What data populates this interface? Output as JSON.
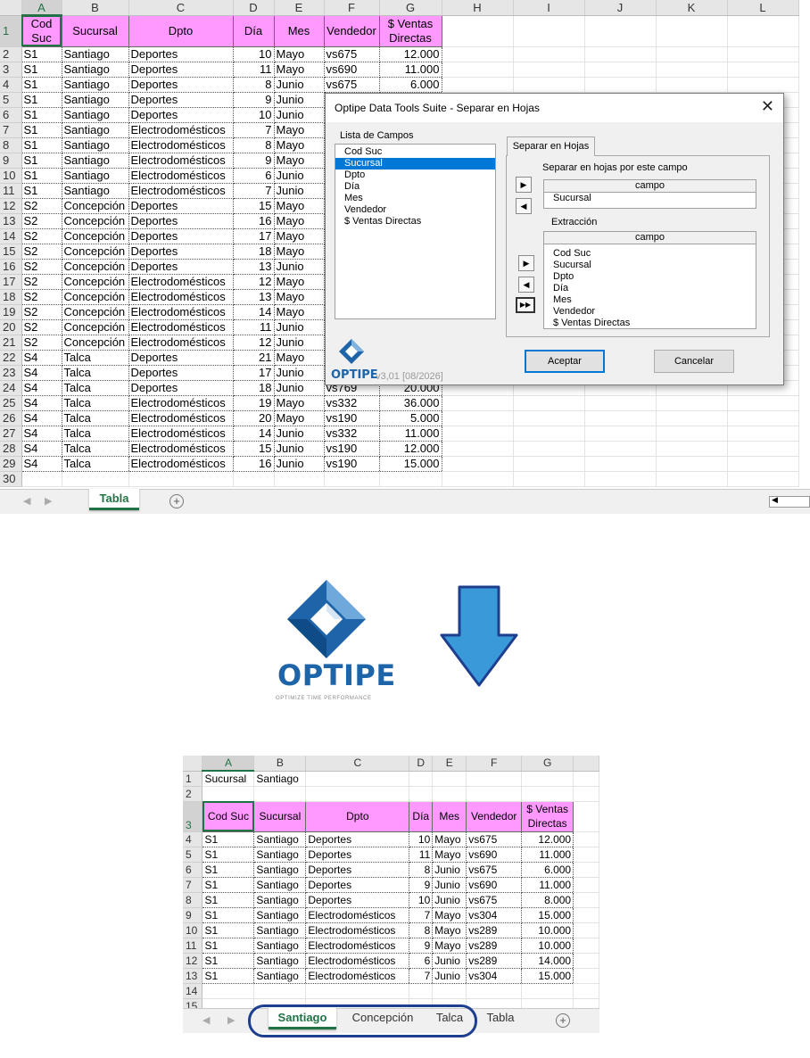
{
  "columns": [
    "A",
    "B",
    "C",
    "D",
    "E",
    "F",
    "G",
    "H",
    "I",
    "J",
    "K",
    "L"
  ],
  "headers": [
    "Cod Suc",
    "Sucursal",
    "Dpto",
    "Día",
    "Mes",
    "Vendedor",
    "$ Ventas Directas"
  ],
  "top_rows": [
    [
      "S1",
      "Santiago",
      "Deportes",
      "10",
      "Mayo",
      "vs675",
      "12.000"
    ],
    [
      "S1",
      "Santiago",
      "Deportes",
      "11",
      "Mayo",
      "vs690",
      "11.000"
    ],
    [
      "S1",
      "Santiago",
      "Deportes",
      "8",
      "Junio",
      "vs675",
      "6.000"
    ],
    [
      "S1",
      "Santiago",
      "Deportes",
      "9",
      "Junio",
      "",
      ""
    ],
    [
      "S1",
      "Santiago",
      "Deportes",
      "10",
      "Junio",
      "",
      ""
    ],
    [
      "S1",
      "Santiago",
      "Electrodomésticos",
      "7",
      "Mayo",
      "",
      ""
    ],
    [
      "S1",
      "Santiago",
      "Electrodomésticos",
      "8",
      "Mayo",
      "",
      ""
    ],
    [
      "S1",
      "Santiago",
      "Electrodomésticos",
      "9",
      "Mayo",
      "",
      ""
    ],
    [
      "S1",
      "Santiago",
      "Electrodomésticos",
      "6",
      "Junio",
      "",
      ""
    ],
    [
      "S1",
      "Santiago",
      "Electrodomésticos",
      "7",
      "Junio",
      "",
      ""
    ],
    [
      "S2",
      "Concepción",
      "Deportes",
      "15",
      "Mayo",
      "",
      ""
    ],
    [
      "S2",
      "Concepción",
      "Deportes",
      "16",
      "Mayo",
      "",
      ""
    ],
    [
      "S2",
      "Concepción",
      "Deportes",
      "17",
      "Mayo",
      "",
      ""
    ],
    [
      "S2",
      "Concepción",
      "Deportes",
      "18",
      "Mayo",
      "",
      ""
    ],
    [
      "S2",
      "Concepción",
      "Deportes",
      "13",
      "Junio",
      "",
      ""
    ],
    [
      "S2",
      "Concepción",
      "Electrodomésticos",
      "12",
      "Mayo",
      "",
      ""
    ],
    [
      "S2",
      "Concepción",
      "Electrodomésticos",
      "13",
      "Mayo",
      "",
      ""
    ],
    [
      "S2",
      "Concepción",
      "Electrodomésticos",
      "14",
      "Mayo",
      "",
      ""
    ],
    [
      "S2",
      "Concepción",
      "Electrodomésticos",
      "11",
      "Junio",
      "",
      ""
    ],
    [
      "S2",
      "Concepción",
      "Electrodomésticos",
      "12",
      "Junio",
      "",
      ""
    ],
    [
      "S4",
      "Talca",
      "Deportes",
      "21",
      "Mayo",
      "",
      ""
    ],
    [
      "S4",
      "Talca",
      "Deportes",
      "17",
      "Junio",
      "",
      ""
    ],
    [
      "S4",
      "Talca",
      "Deportes",
      "18",
      "Junio",
      "vs769",
      "20.000"
    ],
    [
      "S4",
      "Talca",
      "Electrodomésticos",
      "19",
      "Mayo",
      "vs332",
      "36.000"
    ],
    [
      "S4",
      "Talca",
      "Electrodomésticos",
      "20",
      "Mayo",
      "vs190",
      "5.000"
    ],
    [
      "S4",
      "Talca",
      "Electrodomésticos",
      "14",
      "Junio",
      "vs332",
      "11.000"
    ],
    [
      "S4",
      "Talca",
      "Electrodomésticos",
      "15",
      "Junio",
      "vs190",
      "12.000"
    ],
    [
      "S4",
      "Talca",
      "Electrodomésticos",
      "16",
      "Junio",
      "vs190",
      "15.000"
    ]
  ],
  "top_tabs": {
    "active": "Tabla"
  },
  "dialog": {
    "title": "Optipe Data Tools Suite - Separar en Hojas",
    "close_glyph": "✕",
    "fields_label": "Lista de Campos",
    "fields": [
      "Cod Suc",
      "Sucursal",
      "Dpto",
      "Día",
      "Mes",
      "Vendedor",
      "$ Ventas Directas"
    ],
    "selected_field": "Sucursal",
    "tab_label": "Separar en Hojas",
    "split_label": "Separar en hojas por este campo",
    "split_header": "campo",
    "split_items": [
      "Sucursal"
    ],
    "extract_label": "Extracción",
    "extract_header": "campo",
    "extract_items": [
      "Cod Suc",
      "Sucursal",
      "Dpto",
      "Día",
      "Mes",
      "Vendedor",
      "$ Ventas Directas"
    ],
    "accept": "Aceptar",
    "cancel": "Cancelar",
    "version": "v3,01 [08/2026]",
    "logo_text": "OPTIPE"
  },
  "logo": {
    "word": "OPTIPE",
    "tagline": "OPTIMIZE TIME PERFORMANCE",
    "color": "#1e64a8"
  },
  "arrow_color": "#3a9ad9",
  "bottom": {
    "columns": [
      "A",
      "B",
      "C",
      "D",
      "E",
      "F",
      "G"
    ],
    "row1": [
      "Sucursal",
      "Santiago"
    ],
    "rows": [
      [
        "S1",
        "Santiago",
        "Deportes",
        "10",
        "Mayo",
        "vs675",
        "12.000"
      ],
      [
        "S1",
        "Santiago",
        "Deportes",
        "11",
        "Mayo",
        "vs690",
        "11.000"
      ],
      [
        "S1",
        "Santiago",
        "Deportes",
        "8",
        "Junio",
        "vs675",
        "6.000"
      ],
      [
        "S1",
        "Santiago",
        "Deportes",
        "9",
        "Junio",
        "vs690",
        "11.000"
      ],
      [
        "S1",
        "Santiago",
        "Deportes",
        "10",
        "Junio",
        "vs675",
        "8.000"
      ],
      [
        "S1",
        "Santiago",
        "Electrodomésticos",
        "7",
        "Mayo",
        "vs304",
        "15.000"
      ],
      [
        "S1",
        "Santiago",
        "Electrodomésticos",
        "8",
        "Mayo",
        "vs289",
        "10.000"
      ],
      [
        "S1",
        "Santiago",
        "Electrodomésticos",
        "9",
        "Mayo",
        "vs289",
        "10.000"
      ],
      [
        "S1",
        "Santiago",
        "Electrodomésticos",
        "6",
        "Junio",
        "vs289",
        "14.000"
      ],
      [
        "S1",
        "Santiago",
        "Electrodomésticos",
        "7",
        "Junio",
        "vs304",
        "15.000"
      ]
    ],
    "tabs": [
      "Santiago",
      "Concepción",
      "Talca",
      "Tabla"
    ],
    "active_tab": "Santiago"
  },
  "colors": {
    "header_fill": "#ff99ff",
    "excel_green": "#217346",
    "highlight": "#1e3f8f"
  }
}
